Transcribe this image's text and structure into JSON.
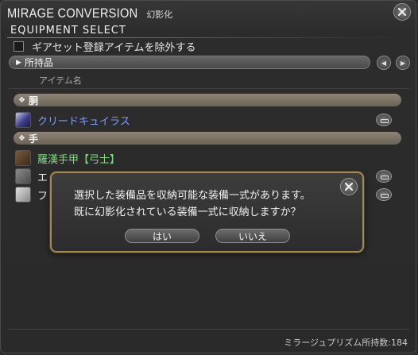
{
  "window": {
    "title": "MIRAGE CONVERSION",
    "title_sub": "幻影化",
    "subtitle": "EQUIPMENT SELECT",
    "exclude_gearset_label": "ギアセット登録アイテムを除外する",
    "source_label": "所持品",
    "column_header": "アイテム名",
    "footer": "ミラージュプリズム所持数:184"
  },
  "categories": [
    {
      "label": "胴"
    },
    {
      "label": "手"
    }
  ],
  "items": [
    {
      "name": "クリードキュイラス",
      "color": "#7d9cff",
      "icon": "body-armor-icon"
    },
    {
      "name": "羅漢手甲【弓士】",
      "color": "#7ae07a",
      "icon": "gauntlet-icon"
    },
    {
      "name": "エ",
      "color": "#e8e8e8",
      "icon": "glove-icon"
    },
    {
      "name": "フ",
      "color": "#e8e8e8",
      "icon": "glove-icon"
    }
  ],
  "dialog": {
    "line1": "選択した装備品を収納可能な装備一式があります。",
    "line2": "既に幻影化されている装備一式に収納しますか？",
    "yes_label": "はい",
    "no_label": "いいえ"
  }
}
